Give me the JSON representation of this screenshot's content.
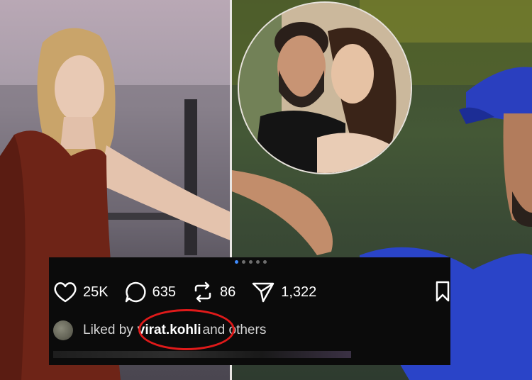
{
  "post": {
    "likes_count": "25K",
    "comments_count": "635",
    "reposts_count": "86",
    "shares_count": "1,322",
    "liked_by_prefix": "Liked by",
    "liked_by_user": "virat.kohli",
    "liked_by_suffix": "and others",
    "carousel_dots": 5,
    "active_dot": 1
  },
  "colors": {
    "panel_background": "#0b0b0b",
    "highlight_circle": "#e01a1a",
    "active_dot": "#3f8cff",
    "jersey_blue": "#2a44c8"
  },
  "icons": [
    "heart-icon",
    "comment-icon",
    "repost-icon",
    "share-icon",
    "bookmark-icon"
  ]
}
